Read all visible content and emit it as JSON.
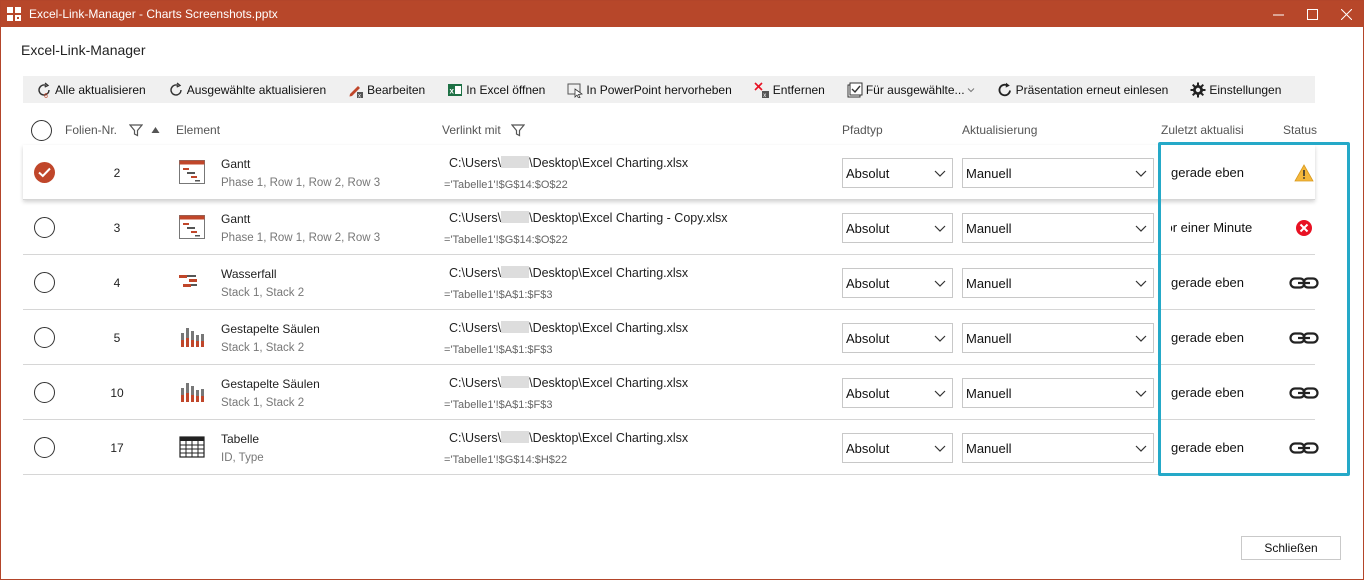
{
  "window": {
    "title": "Excel-Link-Manager - Charts Screenshots.pptx",
    "controls": [
      "—",
      "☐",
      "✕"
    ]
  },
  "dialog_title": "Excel-Link-Manager",
  "toolbar": [
    {
      "name": "refresh-all-button",
      "label": "Alle aktualisieren",
      "icon": "refresh-all-icon"
    },
    {
      "name": "refresh-selected-button",
      "label": "Ausgewählte aktualisieren",
      "icon": "refresh-icon"
    },
    {
      "name": "edit-button",
      "label": "Bearbeiten",
      "icon": "edit-icon"
    },
    {
      "name": "open-excel-button",
      "label": "In Excel öffnen",
      "icon": "excel-icon"
    },
    {
      "name": "highlight-ppt-button",
      "label": "In PowerPoint hervorheben",
      "icon": "highlight-icon"
    },
    {
      "name": "remove-button",
      "label": "Entfernen",
      "icon": "remove-icon"
    },
    {
      "name": "for-selected-button",
      "label": "Für ausgewählte...",
      "icon": "checklist-icon"
    },
    {
      "name": "reload-presentation-button",
      "label": "Präsentation erneut einlesen",
      "icon": "reload-icon"
    },
    {
      "name": "settings-button",
      "label": "Einstellungen",
      "icon": "gear-icon"
    }
  ],
  "columns": {
    "folie": "Folien-Nr.",
    "element": "Element",
    "verlinkt": "Verlinkt mit",
    "pfadtyp": "Pfadtyp",
    "aktualisierung": "Aktualisierung",
    "zuletzt": "Zuletzt aktualisi",
    "status": "Status"
  },
  "rows": [
    {
      "selected": true,
      "folie": "2",
      "icon": "gantt-icon",
      "name": "Gantt",
      "sub": "Phase 1, Row 1, Row 2, Row 3",
      "path_pre": "C:\\Users\\",
      "path_post": "\\Desktop\\Excel Charting.xlsx",
      "range": "='Tabelle1'!$G$14:$O$22",
      "pfadtyp": "Absolut",
      "aktualisierung": "Manuell",
      "zuletzt": "gerade eben",
      "status": "warning-icon"
    },
    {
      "selected": false,
      "folie": "3",
      "icon": "gantt-icon",
      "name": "Gantt",
      "sub": "Phase 1, Row 1, Row 2, Row 3",
      "path_pre": "C:\\Users\\",
      "path_post": "\\Desktop\\Excel Charting - Copy.xlsx",
      "range": "='Tabelle1'!$G$14:$O$22",
      "pfadtyp": "Absolut",
      "aktualisierung": "Manuell",
      "zuletzt": "vor einer Minute",
      "status": "error-icon"
    },
    {
      "selected": false,
      "folie": "4",
      "icon": "waterfall-icon",
      "name": "Wasserfall",
      "sub": "Stack 1, Stack 2",
      "path_pre": "C:\\Users\\",
      "path_post": "\\Desktop\\Excel Charting.xlsx",
      "range": "='Tabelle1'!$A$1:$F$3",
      "pfadtyp": "Absolut",
      "aktualisierung": "Manuell",
      "zuletzt": "gerade eben",
      "status": "link-icon"
    },
    {
      "selected": false,
      "folie": "5",
      "icon": "stacked-column-icon",
      "name": "Gestapelte Säulen",
      "sub": "Stack 1, Stack 2",
      "path_pre": "C:\\Users\\",
      "path_post": "\\Desktop\\Excel Charting.xlsx",
      "range": "='Tabelle1'!$A$1:$F$3",
      "pfadtyp": "Absolut",
      "aktualisierung": "Manuell",
      "zuletzt": "gerade eben",
      "status": "link-icon"
    },
    {
      "selected": false,
      "folie": "10",
      "icon": "stacked-column-icon",
      "name": "Gestapelte Säulen",
      "sub": "Stack 1, Stack 2",
      "path_pre": "C:\\Users\\",
      "path_post": "\\Desktop\\Excel Charting.xlsx",
      "range": "='Tabelle1'!$A$1:$F$3",
      "pfadtyp": "Absolut",
      "aktualisierung": "Manuell",
      "zuletzt": "gerade eben",
      "status": "link-icon"
    },
    {
      "selected": false,
      "folie": "17",
      "icon": "table-icon",
      "name": "Tabelle",
      "sub": "ID, Type",
      "path_pre": "C:\\Users\\",
      "path_post": "\\Desktop\\Excel Charting.xlsx",
      "range": "='Tabelle1'!$G$14:$H$22",
      "pfadtyp": "Absolut",
      "aktualisierung": "Manuell",
      "zuletzt": "gerade eben",
      "status": "link-icon"
    }
  ],
  "close_label": "Schließen",
  "colors": {
    "accent": "#b7472a",
    "highlight": "#25a9c8",
    "warning": "#f4b73b",
    "error": "#e81123"
  }
}
